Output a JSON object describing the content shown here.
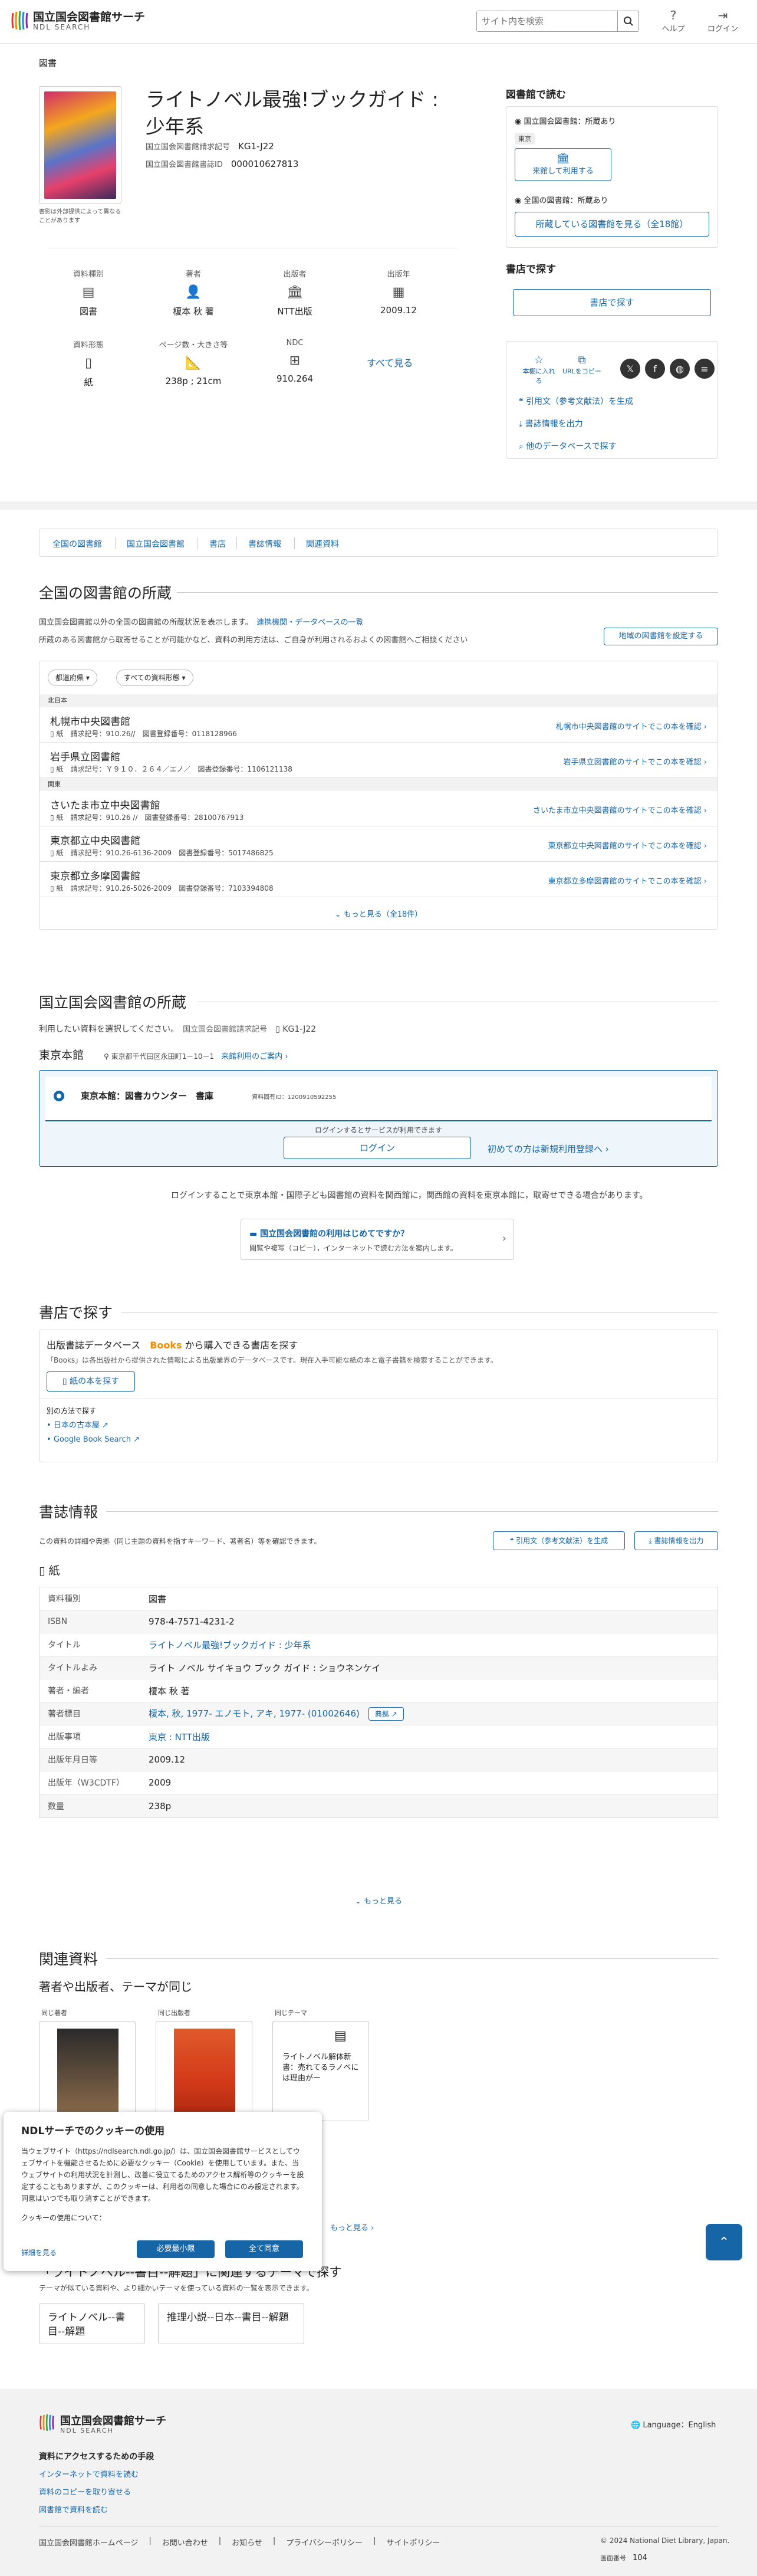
{
  "header": {
    "logo_title": "国立国会図書館サーチ",
    "logo_sub": "NDL SEARCH",
    "search_placeholder": "サイト内を検索",
    "help": "ヘルプ",
    "login": "ログイン"
  },
  "breadcrumb": "図書",
  "book": {
    "cover_note": "書影は外部提供によって異なることがあります",
    "title": "ライトノベル最強!ブックガイド : 少年系",
    "call_no_label": "国立国会図書館請求記号",
    "call_no": "KG1-J22",
    "bib_id_label": "国立国会図書館書誌ID",
    "bib_id": "000010627813",
    "facets": [
      {
        "label": "資料種別",
        "value": "図書",
        "icon": "book-icon"
      },
      {
        "label": "著者",
        "value": "榎本 秋 著",
        "icon": "person-icon"
      },
      {
        "label": "出版者",
        "value": "NTT出版",
        "icon": "building-icon"
      },
      {
        "label": "出版年",
        "value": "2009.12",
        "icon": "calendar-icon"
      },
      {
        "label": "資料形態",
        "value": "紙",
        "icon": "paper-icon"
      },
      {
        "label": "ページ数・大きさ等",
        "value": "238p ; 21cm",
        "icon": "ruler-icon"
      },
      {
        "label": "NDC",
        "value": "910.264",
        "icon": "classification-icon"
      }
    ],
    "see_all": "すべて見る"
  },
  "right_panel": {
    "read_heading": "図書館で読む",
    "ndl_holding": "国立国会図書館：所蔵あり",
    "tokyo_tag": "東京",
    "visit_use": "来館して利用する",
    "national_holding": "全国の図書館：所蔵あり",
    "see_holding_libs": "所蔵している図書館を見る（全18館）",
    "buy_heading": "書店で探す",
    "find_in_store": "書店で探す",
    "bookmark": "本棚に入れる",
    "copy_url": "URLをコピー",
    "cite": "引用文（参考文献法）を生成",
    "export": "書誌情報を出力",
    "other_db": "他のデータベースで探す"
  },
  "anchor_nav": [
    "全国の図書館",
    "国立国会図書館",
    "書店",
    "書誌情報",
    "関連資料"
  ],
  "national": {
    "heading": "全国の図書館の所蔵",
    "desc1": "国立国会図書館以外の全国の図書館の所蔵状況を表示します。",
    "desc1_link": "連携機関・データベースの一覧",
    "desc2": "所蔵のある図書館から取寄せることが可能かなど、資料の利用方法は、ご自身が利用されるおよくの図書館へご相談ください",
    "set_region": "地域の図書館を設定する",
    "filter_pref": "都道府県",
    "filter_form": "すべての資料形態",
    "regions": [
      {
        "name": "北日本",
        "libs": [
          {
            "name": "札幌市中央図書館",
            "form": "紙",
            "call": "910.26//",
            "reg_label": "図書登録番号：",
            "reg": "0118128966",
            "link": "札幌市中央図書館のサイトでこの本を確認"
          },
          {
            "name": "岩手県立図書館",
            "form": "紙",
            "call": "Ｙ９１０．２６４／エノ／",
            "reg_label": "図書登録番号：",
            "reg": "1106121138",
            "link": "岩手県立図書館のサイトでこの本を確認"
          }
        ]
      },
      {
        "name": "関東",
        "libs": [
          {
            "name": "さいたま市立中央図書館",
            "form": "紙",
            "call": "910.26 //",
            "reg_label": "図書登録番号：",
            "reg": "28100767913",
            "link": "さいたま市立中央図書館のサイトでこの本を確認"
          },
          {
            "name": "東京都立中央図書館",
            "form": "紙",
            "call": "910.26-6136-2009",
            "reg_label": "図書登録番号：",
            "reg": "5017486825",
            "link": "東京都立中央図書館のサイトでこの本を確認"
          },
          {
            "name": "東京都立多摩図書館",
            "form": "紙",
            "call": "910.26-5026-2009",
            "reg_label": "図書登録番号：",
            "reg": "7103394808",
            "link": "東京都立多摩図書館のサイトでこの本を確認"
          }
        ]
      }
    ],
    "call_label": "請求記号：",
    "more": "もっと見る（全18件）"
  },
  "ndl": {
    "heading": "国立国会図書館の所蔵",
    "select_desc": "利用したい資料を選択してください。",
    "call_label": "国立国会図書館請求記号",
    "call_no": "KG1-J22",
    "tokyo": "東京本館",
    "address": "東京都千代田区永田町1－10－1",
    "visit_guide": "来館利用のご案内",
    "counter": "東京本館：図書カウンター　書庫",
    "item_id": "資料固有ID：1200910592255",
    "login_note": "ログインするとサービスが利用できます",
    "login": "ログイン",
    "register": "初めての方は新規利用登録へ",
    "kansai_note": "ログインすることで東京本館・国際子ども図書館の資料を関西館に，関西館の資料を東京本館に，取寄せできる場合があります。",
    "first_time_title": "国立国会図書館の利用はじめてですか？",
    "first_time_desc": "閲覧や複写（コピー），インターネットで読む方法を案内します。"
  },
  "store": {
    "heading": "書店で探す",
    "desc_a": "出版書誌データベース",
    "books_brand": "Books",
    "desc_b": "から購入できる書店を探す",
    "desc2": "「Books」は各出版社から提供された情報による出版業界のデータベースです。現在入手可能な紙の本と電子書籍を検索することができます。",
    "paper_book": "紙の本を探す",
    "other_way": "別の方法で探す",
    "link1": "日本の古本屋",
    "link2": "Google Book Search"
  },
  "biblio": {
    "heading": "書誌情報",
    "desc": "この資料の詳細や典拠（同じ主題の資料を指すキーワード、著者名）等を確認できます。",
    "cite": "引用文（参考文献法）を生成",
    "export": "書誌情報を出力",
    "form": "紙",
    "rows": [
      {
        "k": "資料種別",
        "v": "図書"
      },
      {
        "k": "ISBN",
        "v": "978-4-7571-4231-2"
      },
      {
        "k": "タイトル",
        "v": "ライトノベル最強!ブックガイド : 少年系"
      },
      {
        "k": "タイトルよみ",
        "v": "ライト ノベル サイキョウ ブック ガイド : ショウネンケイ"
      },
      {
        "k": "著者・編者",
        "v": "榎本 秋 著"
      },
      {
        "k": "著者標目",
        "v": "榎本, 秋, 1977- エノモト, アキ, 1977- (01002646)"
      },
      {
        "k": "出版事項",
        "v": "東京 : NTT出版"
      },
      {
        "k": "出版年月日等",
        "v": "2009.12"
      },
      {
        "k": "出版年（W3CDTF）",
        "v": "2009"
      },
      {
        "k": "数量",
        "v": "238p"
      }
    ],
    "authority_btn": "典拠",
    "more": "もっと見る"
  },
  "related": {
    "heading": "関連資料",
    "sub": "著者や出版者、テーマが同じ",
    "tags": [
      "同じ著者",
      "同じ出版者",
      "同じテーマ"
    ],
    "card3_text": "ライトノベル解体新書：売れてるラノベには理由がー",
    "more": "もっと見る",
    "theme_heading": "「ライトノベル--書目--解題」に関連するテーマで探す",
    "theme_desc": "テーマが似ている資料や、より細かいテーマを使っている資料の一覧を表示できます。",
    "themes": [
      "ライトノベル--書目--解題",
      "推理小説--日本--書目--解題"
    ]
  },
  "cookie": {
    "title": "NDLサーチでのクッキーの使用",
    "body": "当ウェブサイト（https://ndlsearch.ndl.go.jp/）は、国立国会図書館サービスとしてウェブサイトを機能させるために必要なクッキー（Cookie）を使用しています。また、当ウェブサイトの利用状況を計測し、改善に役立てるためのアクセス解析等のクッキーを設定することもありますが、このクッキーは、利用者の同意した場合にのみ設定されます。同意はいつでも取り消すことができます。",
    "about": "クッキーの使用について：",
    "detail": "詳細を見る",
    "necessary_only": "必要最小限",
    "accept_all": "全て同意"
  },
  "footer": {
    "logo_title": "国立国会図書館サーチ",
    "logo_sub": "NDL SEARCH",
    "language": "Language：English",
    "access_head": "資料にアクセスするための手段",
    "links": [
      "インターネットで資料を読む",
      "資料のコピーを取り寄せる",
      "図書館で資料を読む"
    ],
    "bottom_links": [
      "国立国会図書館ホームページ",
      "お問い合わせ",
      "お知らせ",
      "プライバシーポリシー",
      "サイトポリシー"
    ],
    "copyright": "© 2024 National Diet Library, Japan.",
    "page_no_label": "画面番号",
    "page_no": "104"
  },
  "colors": {
    "accent": "#1565a7",
    "books_orange": "#f08c00"
  }
}
